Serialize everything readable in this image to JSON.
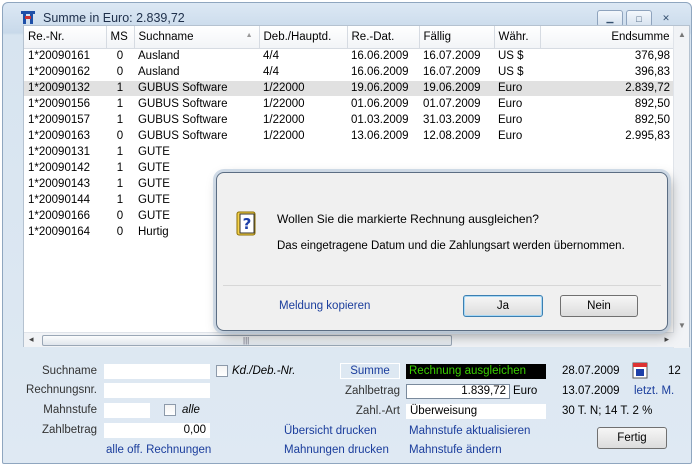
{
  "window": {
    "title": "Summe in Euro: 2.839,72"
  },
  "grid": {
    "columns": [
      "Re.-Nr.",
      "MS",
      "Suchname",
      "Deb./Hauptd.",
      "Re.-Dat.",
      "Fällig",
      "Währ.",
      "Endsumme"
    ],
    "rows": [
      {
        "nr": "1*20090161",
        "ms": "0",
        "name": "Ausland",
        "deb": "4/4",
        "dat": "16.06.2009",
        "faellig": "16.07.2009",
        "waehr": "US $",
        "summe": "376,98"
      },
      {
        "nr": "1*20090162",
        "ms": "0",
        "name": "Ausland",
        "deb": "4/4",
        "dat": "16.06.2009",
        "faellig": "16.07.2009",
        "waehr": "US $",
        "summe": "396,83"
      },
      {
        "nr": "1*20090132",
        "ms": "1",
        "name": "GUBUS Software",
        "deb": "1/22000",
        "dat": "19.06.2009",
        "faellig": "19.06.2009",
        "waehr": "Euro",
        "summe": "2.839,72"
      },
      {
        "nr": "1*20090156",
        "ms": "1",
        "name": "GUBUS Software",
        "deb": "1/22000",
        "dat": "01.06.2009",
        "faellig": "01.07.2009",
        "waehr": "Euro",
        "summe": "892,50"
      },
      {
        "nr": "1*20090157",
        "ms": "1",
        "name": "GUBUS Software",
        "deb": "1/22000",
        "dat": "01.03.2009",
        "faellig": "31.03.2009",
        "waehr": "Euro",
        "summe": "892,50"
      },
      {
        "nr": "1*20090163",
        "ms": "0",
        "name": "GUBUS Software",
        "deb": "1/22000",
        "dat": "13.06.2009",
        "faellig": "12.08.2009",
        "waehr": "Euro",
        "summe": "2.995,83"
      },
      {
        "nr": "1*20090131",
        "ms": "1",
        "name": "GUTE"
      },
      {
        "nr": "1*20090142",
        "ms": "1",
        "name": "GUTE"
      },
      {
        "nr": "1*20090143",
        "ms": "1",
        "name": "GUTE"
      },
      {
        "nr": "1*20090144",
        "ms": "1",
        "name": "GUTE"
      },
      {
        "nr": "1*20090166",
        "ms": "0",
        "name": "GUTE"
      },
      {
        "nr": "1*20090164",
        "ms": "0",
        "name": "Hurtig"
      }
    ]
  },
  "dialog": {
    "question": "Wollen Sie die markierte Rechnung ausgleichen?",
    "info": "Das eingetragene Datum und die Zahlungsart werden übernommen.",
    "copy_link": "Meldung kopieren",
    "yes": "Ja",
    "no": "Nein"
  },
  "form": {
    "suchname_label": "Suchname",
    "rechnungsnr_label": "Rechnungsnr.",
    "mahnstufe_label": "Mahnstufe",
    "zahlbetrag_label": "Zahlbetrag",
    "zahlbetrag_value": "0,00",
    "alle_label": "alle",
    "kd_label": "Kd./Deb.-Nr.",
    "summe_button": "Summe",
    "status": "Rechnung ausgleichen",
    "zahlbetrag2_label": "Zahlbetrag",
    "zahlbetrag2_value": "1.839,72",
    "currency": "Euro",
    "zahlart_label": "Zahl.-Art",
    "zahlart_value": "Überweisung",
    "date1": "28.07.2009",
    "count": "12",
    "date2": "13.07.2009",
    "letzt_link": "letzt. M.",
    "terms": "30 T. N; 14 T. 2 %",
    "alle_off_link": "alle off. Rechnungen",
    "uebersicht_link": "Übersicht drucken",
    "mahnungen_link": "Mahnungen drucken",
    "mahnstufe_akt_link": "Mahnstufe aktualisieren",
    "mahnstufe_aendern_link": "Mahnstufe ändern",
    "fertig": "Fertig"
  },
  "colors": {
    "status_bg": "#000000",
    "status_fg": "#39d000",
    "link": "#1a3d9c",
    "selected_row": "#e1e1e1"
  }
}
